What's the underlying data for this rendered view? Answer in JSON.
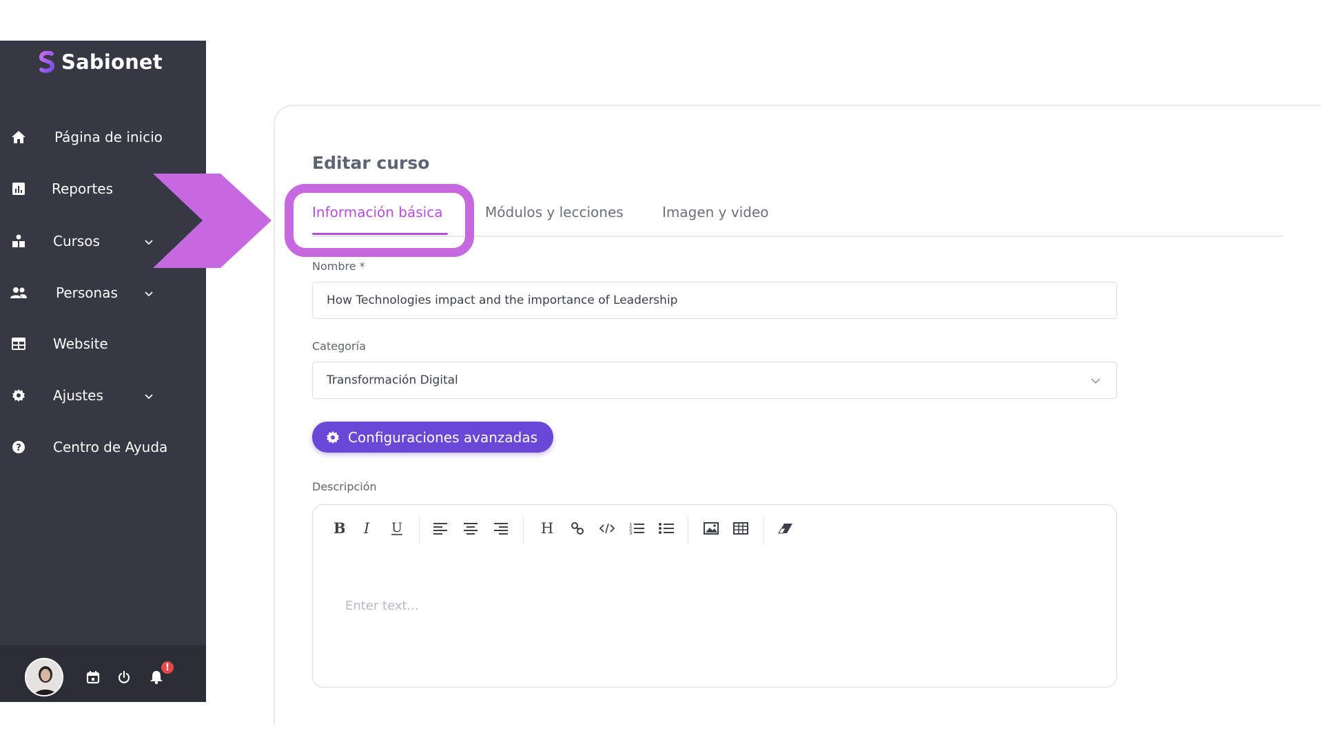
{
  "brand": {
    "name": "Sabionet"
  },
  "sidebar": {
    "items": [
      {
        "label": "Página de inicio",
        "icon": "home-icon",
        "has_submenu": false
      },
      {
        "label": "Reportes",
        "icon": "bar-chart-icon",
        "has_submenu": false
      },
      {
        "label": "Cursos",
        "icon": "courses-icon",
        "has_submenu": true
      },
      {
        "label": "Personas",
        "icon": "users-icon",
        "has_submenu": true
      },
      {
        "label": "Website",
        "icon": "website-icon",
        "has_submenu": false
      },
      {
        "label": "Ajustes",
        "icon": "gear-icon",
        "has_submenu": true
      },
      {
        "label": "Centro de Ayuda",
        "icon": "help-icon",
        "has_submenu": false
      }
    ],
    "footer": {
      "notification_count": "!"
    }
  },
  "main": {
    "title": "Editar curso",
    "tabs": [
      {
        "label": "Información básica",
        "active": true
      },
      {
        "label": "Módulos y lecciones",
        "active": false
      },
      {
        "label": "Imagen y video",
        "active": false
      }
    ],
    "fields": {
      "name_label": "Nombre *",
      "name_value": "How Technologies impact and the importance of Leadership",
      "category_label": "Categoría",
      "category_value": "Transformación Digital",
      "advanced_button": "Configuraciones avanzadas",
      "description_label": "Descripción",
      "description_placeholder": "Enter text..."
    }
  },
  "colors": {
    "sidebar_bg": "#363944",
    "accent_purple": "#b84ee0",
    "highlight": "#c668e0",
    "button_purple": "#6b47d8",
    "badge_red": "#e4494a"
  }
}
